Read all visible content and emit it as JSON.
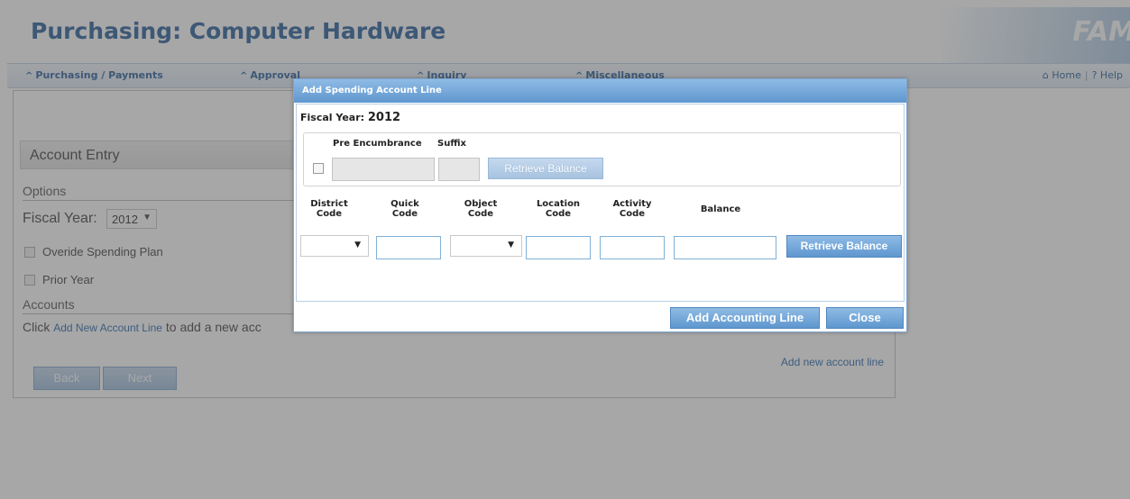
{
  "page": {
    "title": "Purchasing: Computer Hardware",
    "logo_text": "FAM"
  },
  "nav": {
    "items": [
      "Purchasing / Payments",
      "Approval",
      "Inquiry",
      "Miscellaneous"
    ],
    "home": "Home",
    "help": "Help",
    "separator": "|"
  },
  "account_entry": {
    "section_title": "Account Entry",
    "options_heading": "Options",
    "fiscal_year_label": "Fiscal Year:",
    "fiscal_year_value": "2012",
    "override_label": "Overide Spending Plan",
    "prior_year_label": "Prior Year",
    "accounts_heading": "Accounts",
    "click_prefix": "Click",
    "click_link": "Add New Account Line",
    "click_suffix": "to add a new acc",
    "add_new_link": "Add new account line",
    "back_button": "Back",
    "next_button": "Next"
  },
  "dialog": {
    "title": "Add Spending Account Line",
    "fiscal_year_label": "Fiscal Year:",
    "fiscal_year_value": "2012",
    "pre_encumbrance_label": "Pre Encumbrance",
    "suffix_label": "Suffix",
    "retrieve_balance_disabled": "Retrieve Balance",
    "columns": {
      "district": [
        "District",
        "Code"
      ],
      "quick": [
        "Quick",
        "Code"
      ],
      "object": [
        "Object",
        "Code"
      ],
      "location": [
        "Location",
        "Code"
      ],
      "activity": [
        "Activity",
        "Code"
      ],
      "balance": "Balance"
    },
    "retrieve_balance": "Retrieve Balance",
    "add_accounting_line": "Add Accounting Line",
    "close": "Close"
  },
  "colors": {
    "brand_blue": "#3e6fa6",
    "button_blue": "#5f97cf",
    "link_blue": "#3e78b8"
  },
  "icons": {
    "nav_caret": "^",
    "home": "⌂",
    "help": "?",
    "dropdown": "▼"
  }
}
